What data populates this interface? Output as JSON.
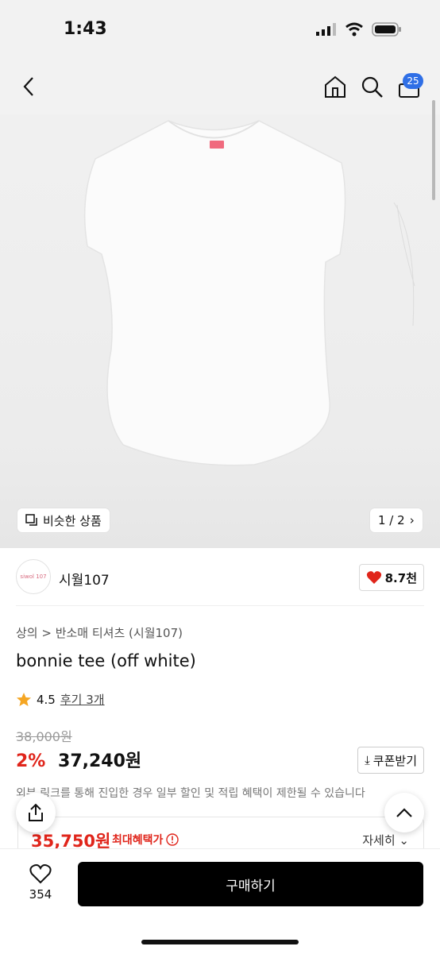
{
  "status": {
    "time": "1:43"
  },
  "nav": {
    "cart_count": "25"
  },
  "gallery": {
    "similar_label": "비슷한 상품",
    "page_indicator": "1 / 2"
  },
  "brand": {
    "name": "시월107",
    "logo_text": "siwol 107",
    "likes": "8.7천"
  },
  "product": {
    "breadcrumb": "상의 > 반소매 티셔츠 (시월107)",
    "title": "bonnie tee (off white)",
    "rating": "4.5",
    "reviews": "후기 3개",
    "original_price": "38,000원",
    "discount": "2%",
    "price": "37,240원",
    "coupon_label": "쿠폰받기",
    "notice": "외부 링크를 통해 진입한 경우 일부 할인 및 적립 혜택이 제한될 수 있습니다"
  },
  "benefit": {
    "price": "35,750원",
    "label": "최대혜택가",
    "detail": "자세히"
  },
  "bottom": {
    "like_count": "354",
    "buy_label": "구매하기"
  },
  "colors": {
    "accent_red": "#e0251b",
    "badge_blue": "#2f6fe6"
  }
}
